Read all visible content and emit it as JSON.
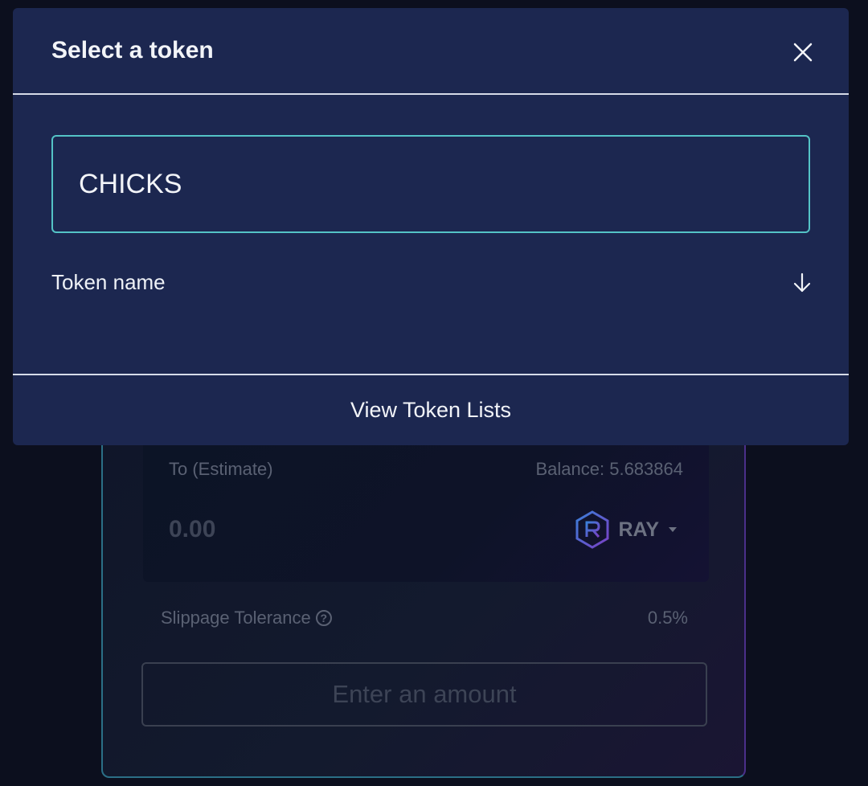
{
  "background": {
    "to_panel": {
      "label": "To (Estimate)",
      "balance": "Balance: 5.683864",
      "amount": "0.00",
      "token_symbol": "RAY"
    },
    "slippage": {
      "label": "Slippage Tolerance",
      "help_glyph": "?",
      "value": "0.5%"
    },
    "action_button_label": "Enter an amount"
  },
  "modal": {
    "title": "Select a token",
    "search_value": "CHICKS",
    "sort_label": "Token name",
    "footer_link": "View Token Lists"
  },
  "icons": {
    "close": "close-icon",
    "sort": "arrow-down-icon",
    "token": "raydium-logo-icon",
    "help": "question-circle-icon"
  },
  "colors": {
    "modal_background": "#1c2750",
    "search_border": "#54c3c6",
    "page_background": "#0c0f1e"
  }
}
